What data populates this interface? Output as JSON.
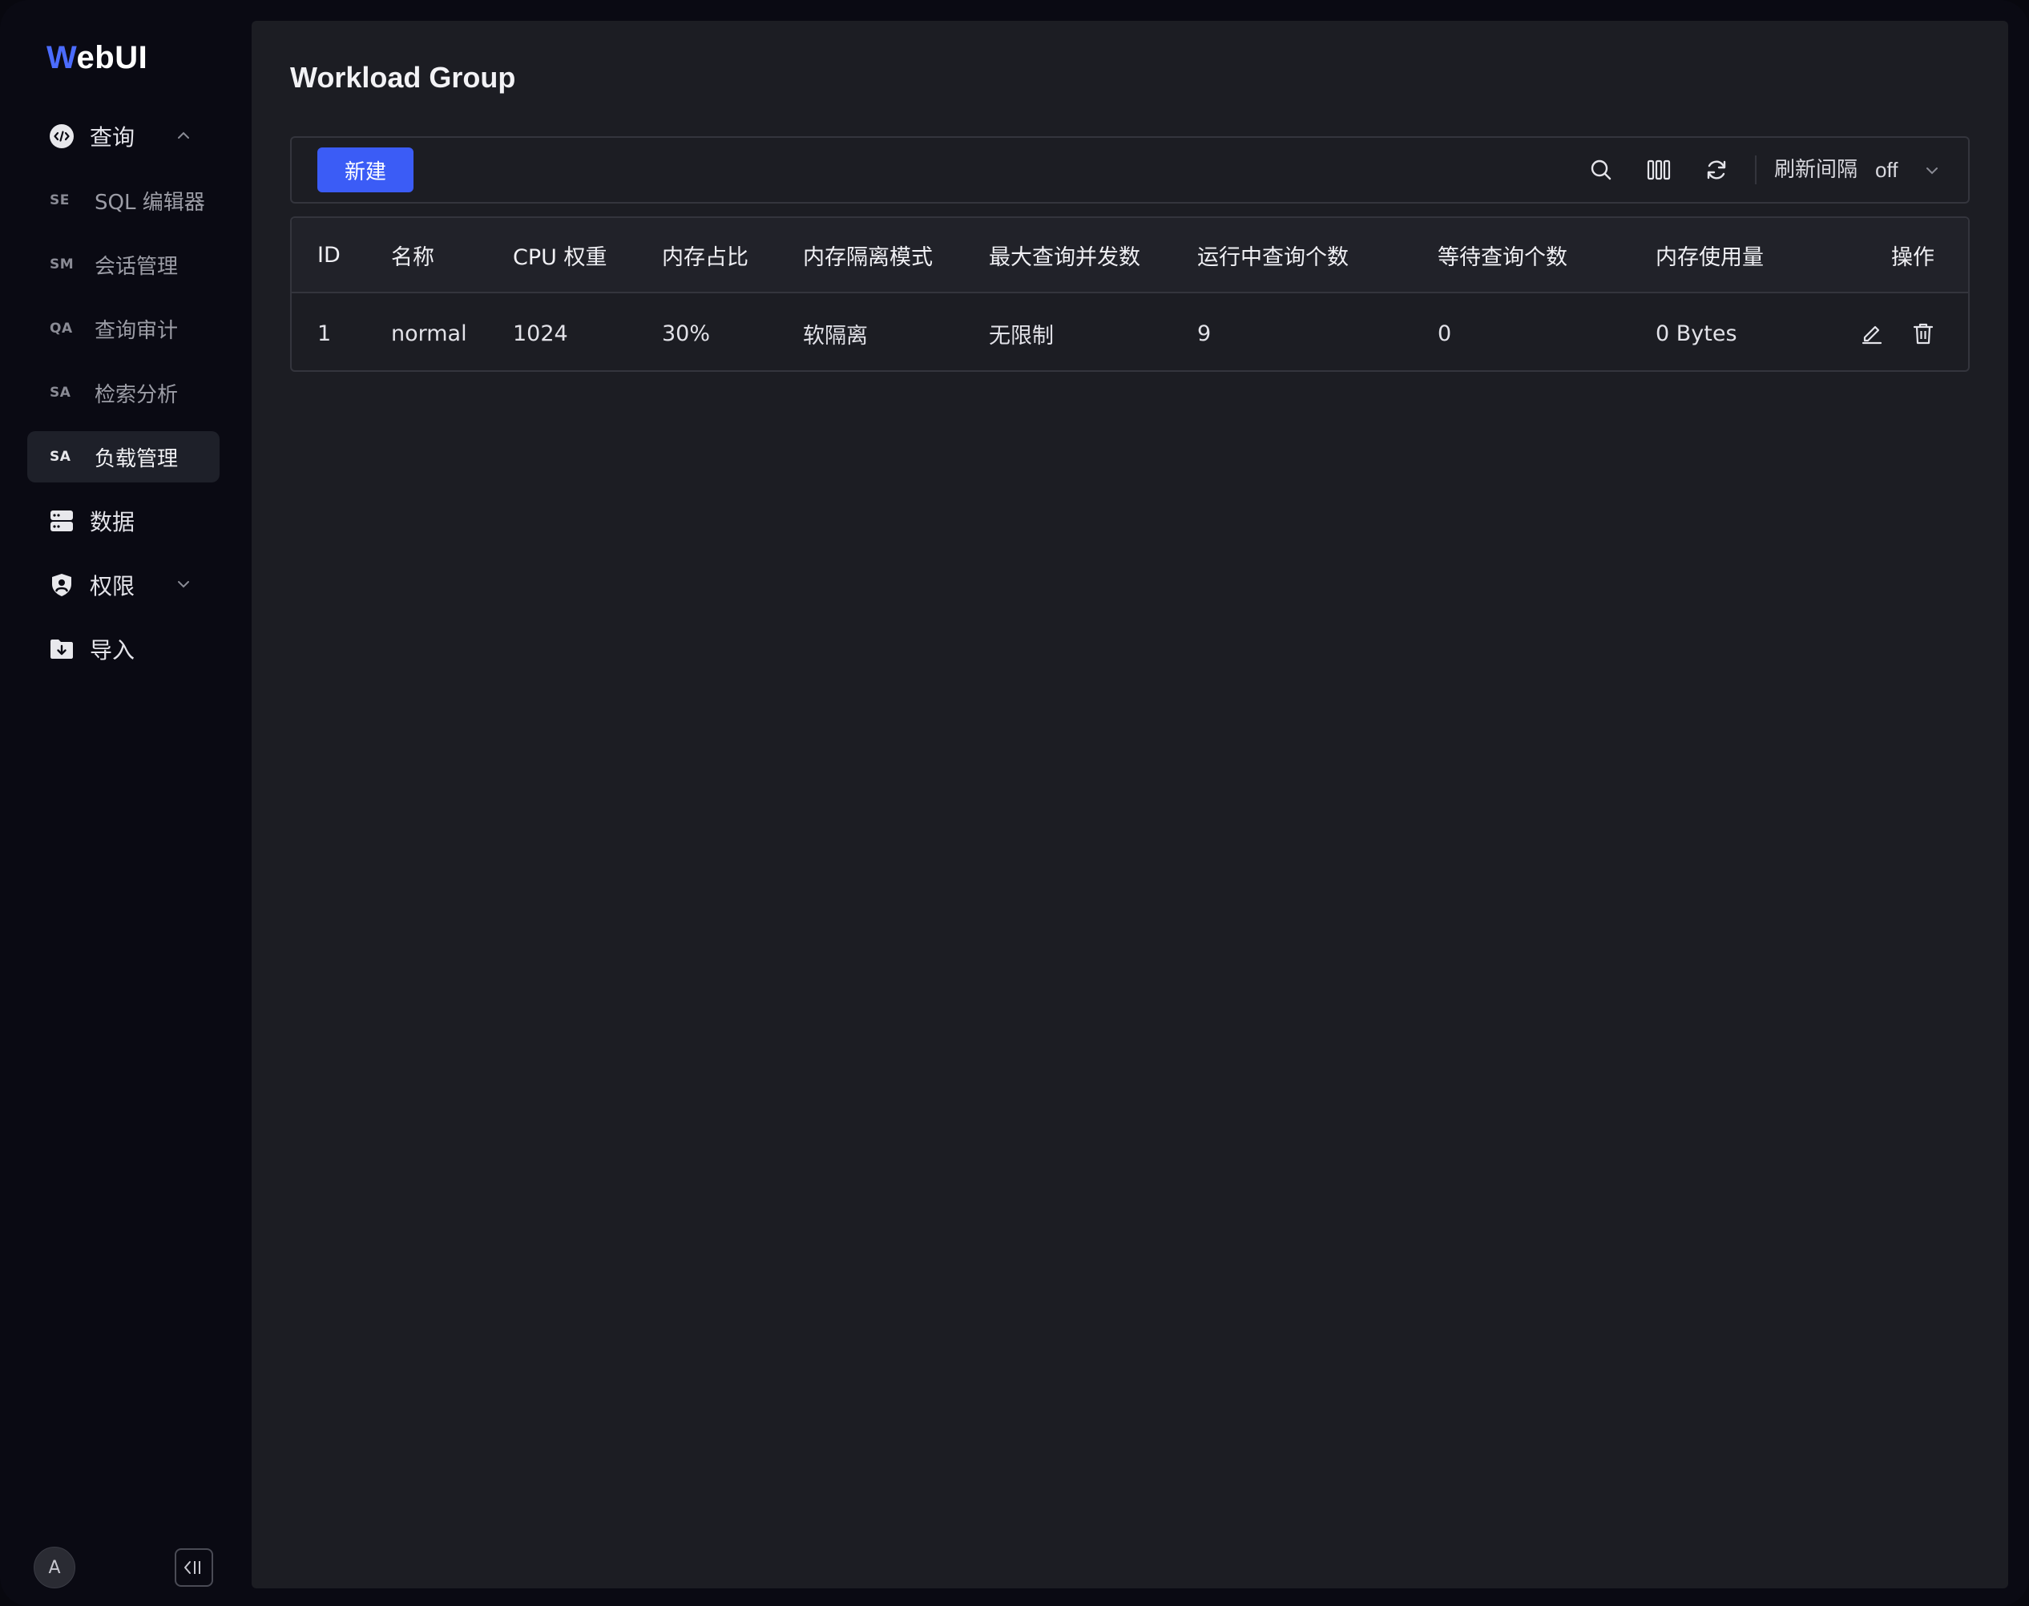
{
  "app": {
    "logo_w": "W",
    "logo_rest": "ebUI"
  },
  "sidebar": {
    "items": [
      {
        "key": "query",
        "label": "查询",
        "icon": "code-circle-icon",
        "expanded": true
      },
      {
        "key": "sql-editor",
        "abbr": "SE",
        "label": "SQL 编辑器"
      },
      {
        "key": "session",
        "abbr": "SM",
        "label": "会话管理"
      },
      {
        "key": "audit",
        "abbr": "QA",
        "label": "查询审计"
      },
      {
        "key": "search",
        "abbr": "SA",
        "label": "检索分析"
      },
      {
        "key": "workload",
        "abbr": "SA",
        "label": "负载管理",
        "active": true
      },
      {
        "key": "data",
        "label": "数据",
        "icon": "database-icon"
      },
      {
        "key": "permission",
        "label": "权限",
        "icon": "shield-user-icon",
        "expanded": false
      },
      {
        "key": "import",
        "label": "导入",
        "icon": "folder-download-icon"
      }
    ],
    "avatar_letter": "A"
  },
  "page": {
    "title": "Workload Group"
  },
  "toolbar": {
    "new_label": "新建",
    "refresh_label": "刷新间隔",
    "refresh_value": "off"
  },
  "table": {
    "columns": [
      "ID",
      "名称",
      "CPU 权重",
      "内存占比",
      "内存隔离模式",
      "最大查询并发数",
      "运行中查询个数",
      "等待查询个数",
      "内存使用量",
      "操作"
    ],
    "rows": [
      {
        "id": "1",
        "name": "normal",
        "cpu": "1024",
        "mem_pct": "30%",
        "isolation": "软隔离",
        "max_concurrency": "无限制",
        "running": "9",
        "waiting": "0",
        "mem_used": "0 Bytes"
      }
    ]
  },
  "colors": {
    "accent": "#3b5cf6",
    "logo_accent": "#4b6cff",
    "panel": "#1c1d23",
    "background": "#0a0a13"
  }
}
